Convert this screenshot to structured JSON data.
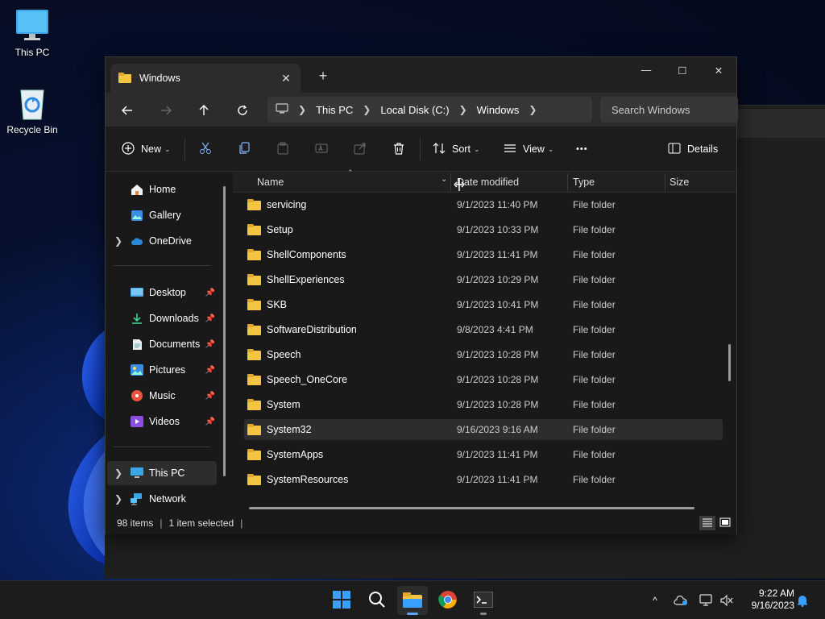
{
  "desktop": {
    "icons": [
      {
        "label": "This PC",
        "icon": "monitor-icon"
      },
      {
        "label": "Recycle Bin",
        "icon": "recycle-bin-icon"
      }
    ]
  },
  "window": {
    "tab_title": "Windows",
    "new_tab_symbol": "+",
    "controls": {
      "minimize": "—",
      "maximize": "☐",
      "close": "✕"
    }
  },
  "navigation": {
    "breadcrumbs": [
      "This PC",
      "Local Disk (C:)",
      "Windows"
    ],
    "search_placeholder": "Search Windows"
  },
  "toolbar": {
    "new_label": "New",
    "sort_label": "Sort",
    "view_label": "View",
    "more_label": "•••",
    "details_label": "Details"
  },
  "sidebar": {
    "items": [
      {
        "label": "Home",
        "icon": "home-icon"
      },
      {
        "label": "Gallery",
        "icon": "gallery-icon"
      },
      {
        "label": "OneDrive",
        "icon": "onedrive-icon"
      },
      {
        "label": "Desktop",
        "icon": "desktop-icon"
      },
      {
        "label": "Downloads",
        "icon": "downloads-icon"
      },
      {
        "label": "Documents",
        "icon": "documents-icon"
      },
      {
        "label": "Pictures",
        "icon": "pictures-icon"
      },
      {
        "label": "Music",
        "icon": "music-icon"
      },
      {
        "label": "Videos",
        "icon": "videos-icon"
      },
      {
        "label": "This PC",
        "icon": "this-pc-icon"
      },
      {
        "label": "Network",
        "icon": "network-icon"
      }
    ]
  },
  "columns": {
    "name": "Name",
    "date": "Date modified",
    "type": "Type",
    "size": "Size"
  },
  "files": [
    {
      "name": "servicing",
      "date": "9/1/2023 11:40 PM",
      "type": "File folder"
    },
    {
      "name": "Setup",
      "date": "9/1/2023 10:33 PM",
      "type": "File folder"
    },
    {
      "name": "ShellComponents",
      "date": "9/1/2023 11:41 PM",
      "type": "File folder"
    },
    {
      "name": "ShellExperiences",
      "date": "9/1/2023 10:29 PM",
      "type": "File folder"
    },
    {
      "name": "SKB",
      "date": "9/1/2023 10:41 PM",
      "type": "File folder"
    },
    {
      "name": "SoftwareDistribution",
      "date": "9/8/2023 4:41 PM",
      "type": "File folder"
    },
    {
      "name": "Speech",
      "date": "9/1/2023 10:28 PM",
      "type": "File folder"
    },
    {
      "name": "Speech_OneCore",
      "date": "9/1/2023 10:28 PM",
      "type": "File folder"
    },
    {
      "name": "System",
      "date": "9/1/2023 10:28 PM",
      "type": "File folder"
    },
    {
      "name": "System32",
      "date": "9/16/2023 9:16 AM",
      "type": "File folder"
    },
    {
      "name": "SystemApps",
      "date": "9/1/2023 11:41 PM",
      "type": "File folder"
    },
    {
      "name": "SystemResources",
      "date": "9/1/2023 11:41 PM",
      "type": "File folder"
    }
  ],
  "status": {
    "item_count": "98 items",
    "selection": "1 item selected"
  },
  "taskbar": {
    "time": "9:22 AM",
    "date": "9/16/2023",
    "tray_chevron": "^"
  }
}
